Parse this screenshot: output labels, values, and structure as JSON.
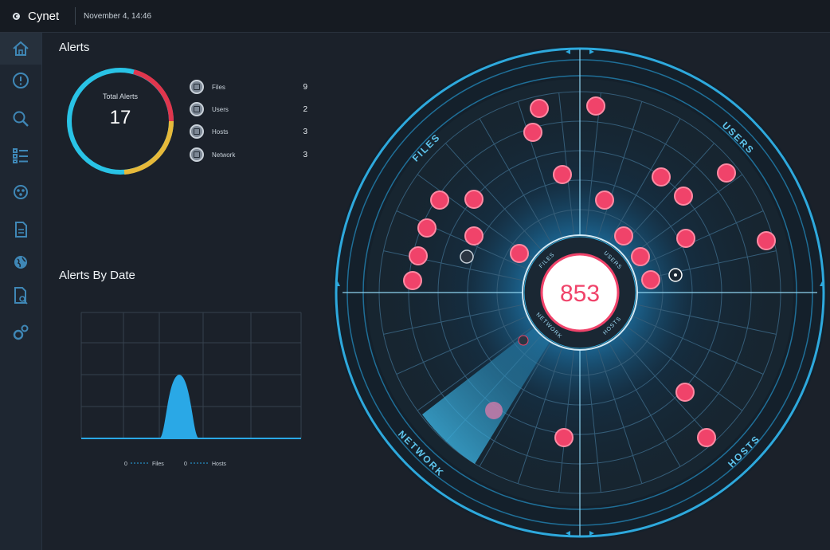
{
  "app": {
    "name": "Cynet",
    "datetime": "November 4, 14:46"
  },
  "sidebar": {
    "items": [
      {
        "icon": "home-icon"
      },
      {
        "icon": "alert-icon"
      },
      {
        "icon": "search-icon"
      },
      {
        "icon": "list-icon"
      },
      {
        "icon": "virus-icon"
      },
      {
        "icon": "document-icon"
      },
      {
        "icon": "globe-icon"
      },
      {
        "icon": "file-search-icon"
      },
      {
        "icon": "settings-icon"
      }
    ]
  },
  "alerts": {
    "title": "Alerts",
    "total_label": "Total Alerts",
    "total_value": "17",
    "legend": [
      {
        "label": "Files",
        "count": "9"
      },
      {
        "label": "Users",
        "count": "2"
      },
      {
        "label": "Hosts",
        "count": "3"
      },
      {
        "label": "Network",
        "count": "3"
      }
    ],
    "ring_colors": [
      "#29c3e6",
      "#e0364d",
      "#e6b93a"
    ]
  },
  "alerts_by_date": {
    "title": "Alerts By Date",
    "legend": [
      {
        "marker": "0",
        "label": "Files"
      },
      {
        "marker": "0",
        "label": "Hosts"
      }
    ]
  },
  "radar": {
    "center_value": "853",
    "outer_labels": {
      "files": "FILES",
      "users": "USERS",
      "network": "NETWORK",
      "hosts": "HOSTS"
    },
    "inner_labels": {
      "files": "FILES",
      "users": "USERS",
      "network": "NETWORK",
      "hosts": "HOSTS"
    },
    "accent": "#2ea9dd",
    "dot_color": "#f0436a"
  }
}
